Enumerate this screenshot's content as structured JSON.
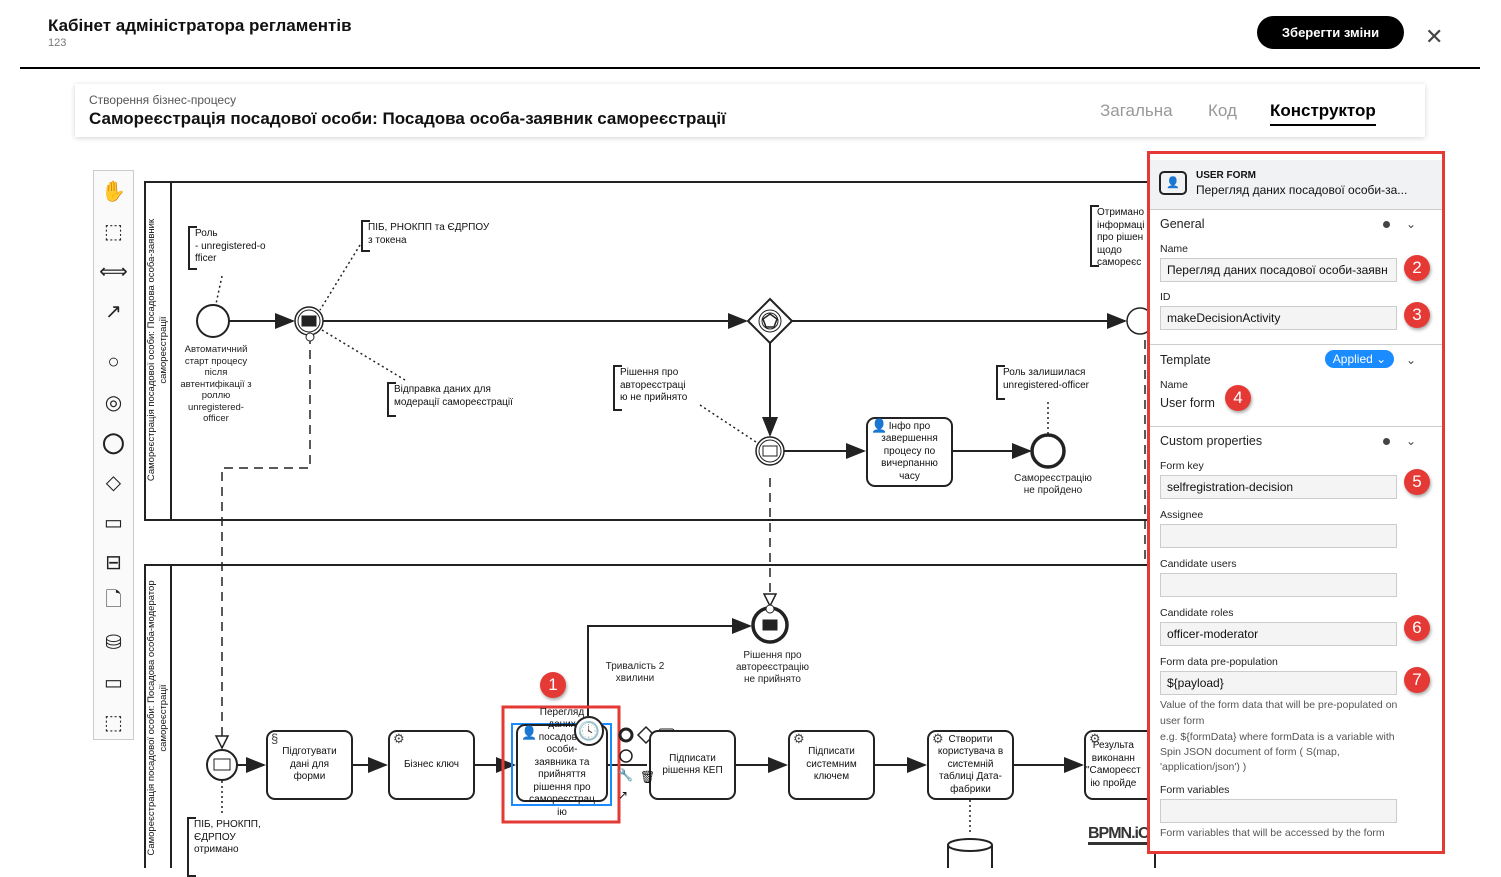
{
  "header": {
    "title": "Кабінет адміністратора регламентів",
    "subtitle": "123",
    "save_label": "Зберегти зміни",
    "close_icon": "close-icon"
  },
  "process": {
    "breadcrumb": "Створення бізнес-процесу",
    "title": "Самореєстрація посадової особи: Посадова особа-заявник самореєстрації",
    "tabs": [
      {
        "label": "Загальна",
        "active": false
      },
      {
        "label": "Код",
        "active": false
      },
      {
        "label": "Конструктор",
        "active": true
      }
    ]
  },
  "palette": [
    "hand-tool",
    "lasso-tool",
    "space-tool",
    "global-connect-tool",
    "start-event",
    "intermediate-event",
    "end-event",
    "gateway",
    "task",
    "subprocess",
    "data-object",
    "data-store",
    "participant",
    "group"
  ],
  "diagram": {
    "lanes": [
      "Самореєстрація посадової особи: Посадова особа-заявник\nсамореєстрації",
      "Самореєстрація посадової особи: Посадова особа-модератор\nсамореєстрації"
    ],
    "annotations": {
      "role": "Роль\n- unregistered-o\nfficer",
      "token": "ПІБ, РНОКПП та ЄДРПОУ\nз токена",
      "send": "Відправка даних для\nмодерації самореєстрації",
      "rejected": "Рішення про\nавтореєстраці\nю не прийнято",
      "received": "Отримано\nінформаці\nпро рішен\nщодо\nсамореєс",
      "role_left": "Роль залишилася\nunregistered-officer",
      "pib": "ПІБ, РНОКПП,\nЄДРПОУ\nотримано"
    },
    "labels": {
      "start": "Автоматичний\nстарт процесу\nпісля\nавтентифікації з\nроллю\nunregistered-\nofficer",
      "end_fail": "Самореєстрацію\nне пройдено",
      "timer": "Тривалість 2\nхвилини",
      "msg_end": "Рішення про\nавтореєстрацію\nне прийнято"
    },
    "tasks": {
      "info": "Інфо про\nзавершення\nпроцесу по\nвичерпанню\nчасу",
      "prepare": "Підготувати\nдані для\nформи",
      "bkey": "Бізнес ключ",
      "review": "Перегляд\nданих\nпосадової\nособи-\nзаявника та\nприйняття\nрішення про\nсамореєстрац\nію",
      "sign": "Підписати\nрішення КЕП",
      "sysign": "Підписати\nсистемним\nключем",
      "create": "Створити\nкористувача в\nсистемній\nтаблиці Дата-\nфабрики",
      "result": "Результа\nвиконанн\n\"Самореєст\nію пройде"
    },
    "watermark": "BPMN.iO"
  },
  "badges": [
    "1",
    "2",
    "3",
    "4",
    "5",
    "6",
    "7"
  ],
  "panel": {
    "type": "USER FORM",
    "name": "Перегляд даних посадової особи-за...",
    "general": {
      "title": "General",
      "name_label": "Name",
      "name_value": "Перегляд даних посадової особи-заявн",
      "id_label": "ID",
      "id_value": "makeDecisionActivity"
    },
    "template": {
      "title": "Template",
      "status": "Applied",
      "name_label": "Name",
      "name_value": "User form"
    },
    "custom": {
      "title": "Custom properties",
      "form_key_label": "Form key",
      "form_key": "selfregistration-decision",
      "assignee_label": "Assignee",
      "assignee": "",
      "cand_users_label": "Candidate users",
      "cand_users": "",
      "cand_roles_label": "Candidate roles",
      "cand_roles": "officer-moderator",
      "prepop_label": "Form data pre-population",
      "prepop": "${payload}",
      "prepop_hint": "Value of the form data that will be pre-populated on user form",
      "prepop_example": "e.g. ${formData} where formData is a variable with Spin JSON document of form ( S(map, 'application/json') )",
      "vars_label": "Form variables",
      "vars": "",
      "vars_hint": "Form variables that will be accessed by the form"
    }
  },
  "colors": {
    "highlight": "#e53935",
    "selection": "#1a8cff",
    "applied": "#1a8cff"
  }
}
